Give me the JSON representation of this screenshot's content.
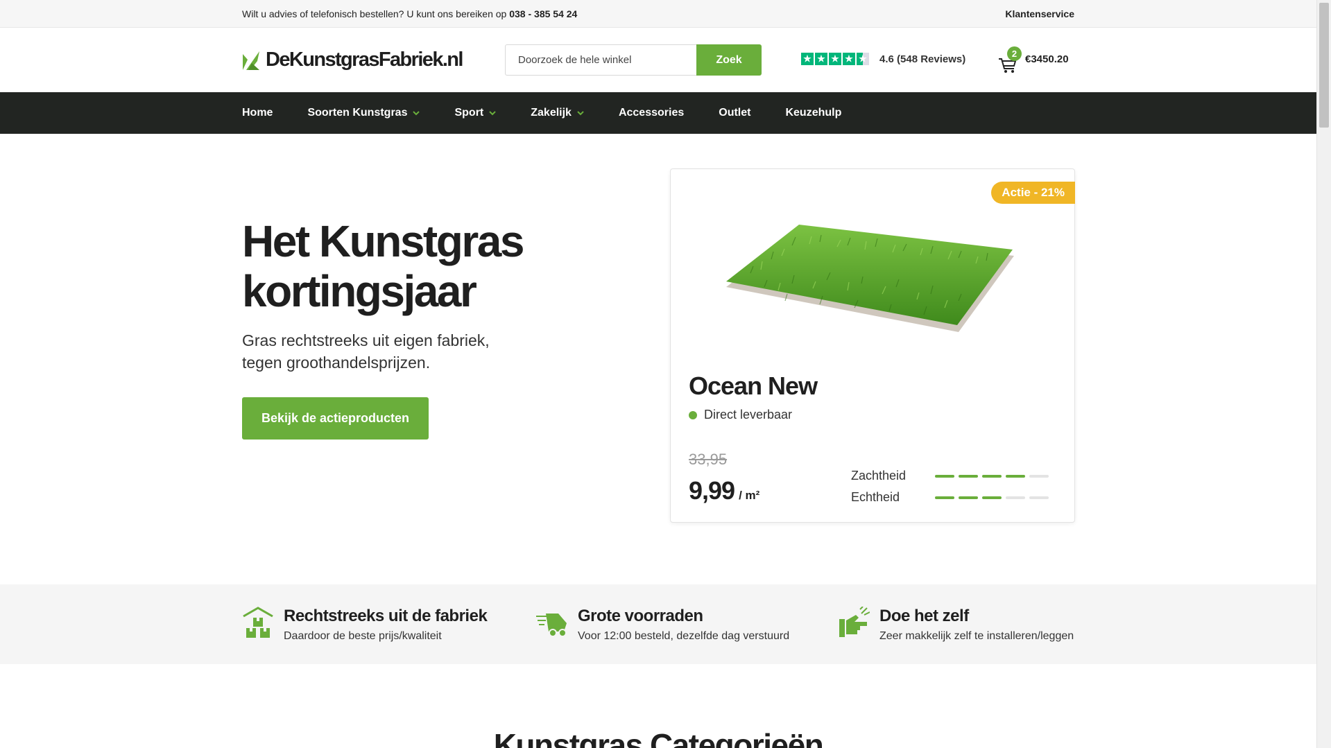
{
  "topbar": {
    "advice_text": "Wilt u advies of telefonisch bestellen? U kunt ons bereiken op",
    "phone": "038 - 385 54 24",
    "service_link": "Klantenservice"
  },
  "header": {
    "logo_text": "DeKunstgrasFabriek.nl",
    "search_placeholder": "Doorzoek de hele winkel",
    "search_button": "Zoek",
    "rating_text": "4.6 (548 Reviews)",
    "rating_value": 4.6,
    "cart_count": "2",
    "cart_total": "€3450.20"
  },
  "nav": {
    "items": [
      {
        "label": "Home",
        "dropdown": false
      },
      {
        "label": "Soorten Kunstgras",
        "dropdown": true
      },
      {
        "label": "Sport",
        "dropdown": true
      },
      {
        "label": "Zakelijk",
        "dropdown": true
      },
      {
        "label": "Accessories",
        "dropdown": false
      },
      {
        "label": "Outlet",
        "dropdown": false
      },
      {
        "label": "Keuzehulp",
        "dropdown": false
      }
    ]
  },
  "hero": {
    "title": "Het Kunstgras kortingsjaar",
    "subtitle": "Gras rechtstreeks uit eigen fabriek, tegen groothandelsprijzen.",
    "cta": "Bekijk de actieproducten"
  },
  "product": {
    "badge": "Actie - 21%",
    "name": "Ocean New",
    "stock": "Direct leverbaar",
    "old_price": "33,95",
    "price": "9,99",
    "unit": "/ m²",
    "specs": [
      {
        "label": "Zachtheid",
        "level": 4,
        "max": 5
      },
      {
        "label": "Echtheid",
        "level": 3,
        "max": 5
      }
    ]
  },
  "usps": [
    {
      "icon": "factory-boxes-icon",
      "title": "Rechtstreeks uit de fabriek",
      "subtitle": "Daardoor de beste prijs/kwaliteit"
    },
    {
      "icon": "delivery-truck-icon",
      "title": "Grote voorraden",
      "subtitle": "Voor 12:00 besteld, dezelfde dag verstuurd"
    },
    {
      "icon": "hand-spray-icon",
      "title": "Doe het zelf",
      "subtitle": "Zeer makkelijk zelf te installeren/leggen"
    }
  ],
  "categories_heading": "Kunstgras Categorieën",
  "colors": {
    "brand_green": "#6aae3b",
    "nav_dark": "#222522",
    "promo_yellow": "#f0b626",
    "trustpilot_green": "#00b67a"
  }
}
